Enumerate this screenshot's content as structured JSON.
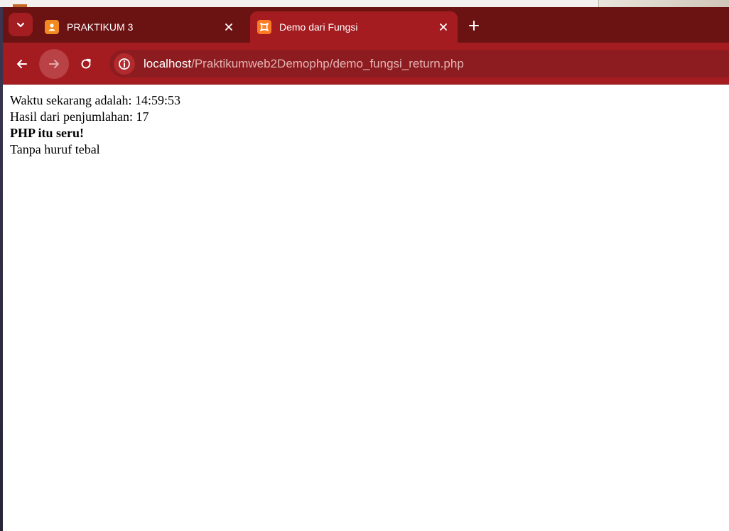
{
  "browser": {
    "tabs": [
      {
        "title": "PRAKTIKUM 3",
        "icon": "person-badge-icon",
        "active": false
      },
      {
        "title": "Demo dari Fungsi",
        "icon": "xampp-icon",
        "active": true
      }
    ],
    "address_bar": {
      "host": "localhost",
      "path": "/Praktikumweb2Demophp/demo_fungsi_return.php"
    },
    "colors": {
      "tabstrip": "#6b1313",
      "toolbar": "#a51c20",
      "omnibox": "#8c1c20"
    }
  },
  "page": {
    "lines": [
      {
        "text": "Waktu sekarang adalah: 14:59:53",
        "bold": false
      },
      {
        "text": "Hasil dari penjumlahan: 17",
        "bold": false
      },
      {
        "text": "PHP itu seru!",
        "bold": true
      },
      {
        "text": "Tanpa huruf tebal",
        "bold": false
      }
    ]
  }
}
